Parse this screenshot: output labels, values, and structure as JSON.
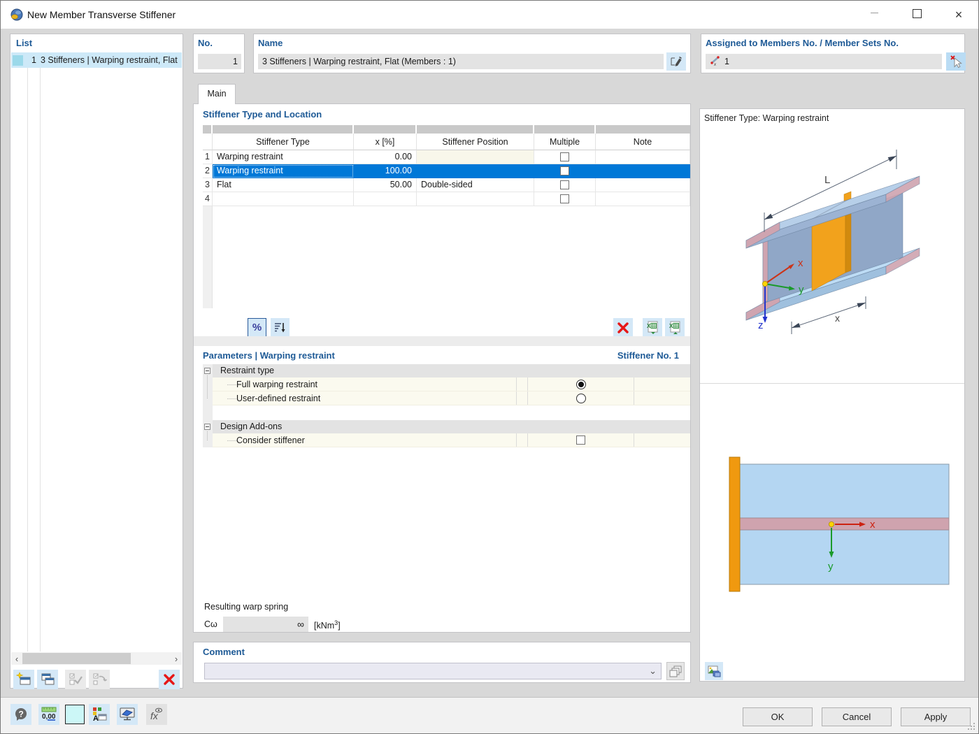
{
  "window": {
    "title": "New Member Transverse Stiffener"
  },
  "list_panel": {
    "header": "List",
    "item_num": "1",
    "item_label": "3 Stiffeners | Warping restraint, Flat"
  },
  "no_panel": {
    "header": "No.",
    "value": "1"
  },
  "name_panel": {
    "header": "Name",
    "value": "3 Stiffeners | Warping restraint, Flat (Members : 1)"
  },
  "assigned_panel": {
    "header": "Assigned to Members No. / Member Sets No.",
    "value": "1"
  },
  "tab_main": "Main",
  "table_section": {
    "title": "Stiffener Type and Location",
    "col_type": "Stiffener Type",
    "col_x": "x [%]",
    "col_position": "Stiffener Position",
    "col_multiple": "Multiple",
    "col_note": "Note",
    "percent_button": "%",
    "rows": [
      {
        "num": "1",
        "type": "Warping restraint",
        "x": "0.00",
        "position": "",
        "selected": false
      },
      {
        "num": "2",
        "type": "Warping restraint",
        "x": "100.00",
        "position": "",
        "selected": true
      },
      {
        "num": "3",
        "type": "Flat",
        "x": "50.00",
        "position": "Double-sided",
        "selected": false
      },
      {
        "num": "4",
        "type": "",
        "x": "",
        "position": "",
        "selected": false
      }
    ]
  },
  "params_section": {
    "title": "Parameters | Warping restraint",
    "stiffener_no": "Stiffener No. 1",
    "group1": "Restraint type",
    "item1": {
      "label": "Full warping restraint",
      "checked": true
    },
    "item2": {
      "label": "User-defined restraint",
      "checked": false
    },
    "group2": "Design Add-ons",
    "item3": {
      "label": "Consider stiffener",
      "checked": false
    }
  },
  "warp_spring": {
    "label": "Resulting warp spring",
    "symbol": "Cω",
    "value": "∞",
    "unit_main": "[kNm",
    "unit_sup": "3",
    "unit_end": "]"
  },
  "comment_section": {
    "title": "Comment",
    "value": ""
  },
  "preview": {
    "title": "Stiffener Type: Warping restraint",
    "dim_length": "L",
    "dim_x": "x",
    "axis_x": "x",
    "axis_y": "y",
    "axis_z": "z",
    "axis2d_x": "x",
    "axis2d_y": "y"
  },
  "footer": {
    "ok": "OK",
    "cancel": "Cancel",
    "apply": "Apply"
  }
}
